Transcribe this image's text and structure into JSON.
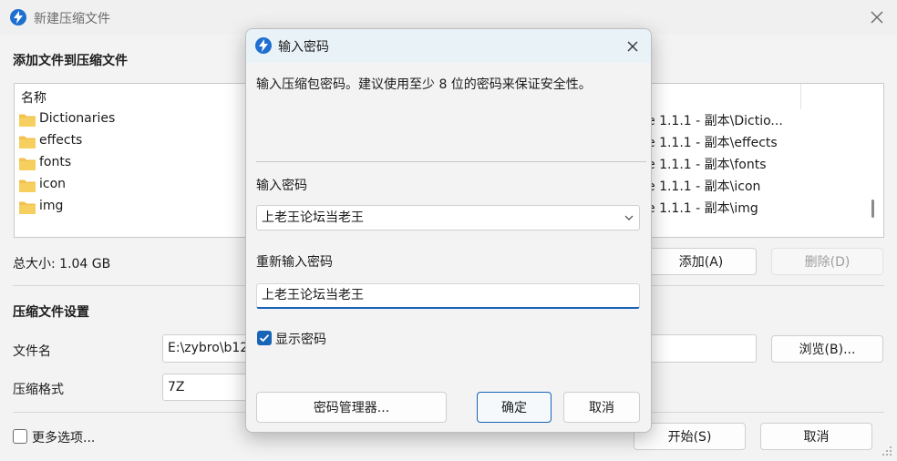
{
  "main": {
    "title": "新建压缩文件",
    "add_heading": "添加文件到压缩文件",
    "list_header": "名称",
    "items": [
      {
        "name": "Dictionaries",
        "path": "e 1.1.1 - 副本\\Dictio..."
      },
      {
        "name": "effects",
        "path": "e 1.1.1 - 副本\\effects"
      },
      {
        "name": "fonts",
        "path": "e 1.1.1 - 副本\\fonts"
      },
      {
        "name": "icon",
        "path": "e 1.1.1 - 副本\\icon"
      },
      {
        "name": "img",
        "path": "e 1.1.1 - 副本\\img"
      }
    ],
    "total_size": "总大小: 1.04 GB",
    "add_button": "添加(A)",
    "delete_button": "删除(D)",
    "settings_heading": "压缩文件设置",
    "filename_label": "文件名",
    "filename_value": "E:\\zybro\\b12",
    "browse_button": "浏览(B)...",
    "format_label": "压缩格式",
    "format_value": "7Z",
    "more_options": "更多选项...",
    "start_button": "开始(S)",
    "cancel_button": "取消"
  },
  "dialog": {
    "title": "输入密码",
    "description": "输入压缩包密码。建议使用至少 8 位的密码来保证安全性。",
    "password_label": "输入密码",
    "password_value": "上老王论坛当老王",
    "reenter_label": "重新输入密码",
    "reenter_value": "上老王论坛当老王",
    "show_password": "显示密码",
    "manager_button": "密码管理器...",
    "ok_button": "确定",
    "cancel_button": "取消"
  },
  "colors": {
    "accent": "#1864b7",
    "folder": "#f2c14e",
    "dialog_titlebar": "#e9f3f7"
  }
}
